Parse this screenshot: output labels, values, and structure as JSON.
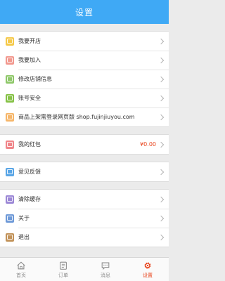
{
  "header": {
    "title": "设置"
  },
  "groups": [
    {
      "items": [
        {
          "label": "我要开店",
          "icon": "store-icon",
          "color": "#f5c94a"
        },
        {
          "label": "我要加入",
          "icon": "join-icon",
          "color": "#f2998f"
        },
        {
          "label": "修改店铺信息",
          "icon": "edit-store-icon",
          "color": "#8fc86a"
        },
        {
          "label": "账号安全",
          "icon": "lock-icon",
          "color": "#86c247"
        },
        {
          "label": "商品上架需登录网页版 shop.fujinjiuyou.com",
          "icon": "web-icon",
          "color": "#f6b66a"
        }
      ]
    },
    {
      "items": [
        {
          "label": "我的红包",
          "icon": "red-packet-icon",
          "color": "#f0868a",
          "value": "¥0.00"
        }
      ]
    },
    {
      "items": [
        {
          "label": "意见反馈",
          "icon": "feedback-icon",
          "color": "#5aa6e6"
        }
      ]
    },
    {
      "items": [
        {
          "label": "清除缓存",
          "icon": "clear-cache-icon",
          "color": "#9c88d6"
        },
        {
          "label": "关于",
          "icon": "about-icon",
          "color": "#6f9ad8"
        },
        {
          "label": "退出",
          "icon": "logout-icon",
          "color": "#c2935a"
        }
      ]
    }
  ],
  "tabs": [
    {
      "label": "首页",
      "icon": "home-icon",
      "active": false
    },
    {
      "label": "订单",
      "icon": "order-icon",
      "active": false
    },
    {
      "label": "消息",
      "icon": "message-icon",
      "active": false
    },
    {
      "label": "设置",
      "icon": "settings-icon",
      "active": true
    }
  ],
  "colors": {
    "accent": "#3fa9f5",
    "active_tab": "#e8431b",
    "money": "#e8431b"
  }
}
